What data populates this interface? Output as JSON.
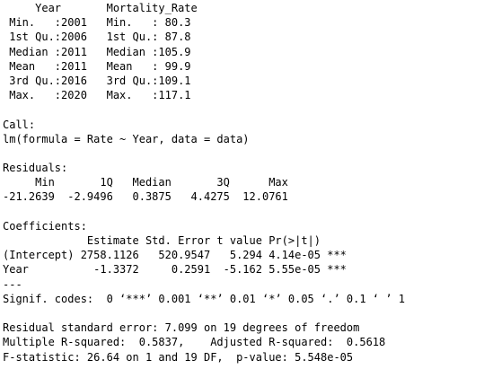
{
  "console_lines": [
    "     Year       Mortality_Rate  ",
    " Min.   :2001   Min.   : 80.3  ",
    " 1st Qu.:2006   1st Qu.: 87.8  ",
    " Median :2011   Median :105.9  ",
    " Mean   :2011   Mean   : 99.9  ",
    " 3rd Qu.:2016   3rd Qu.:109.1  ",
    " Max.   :2020   Max.   :117.1  ",
    "",
    "Call:",
    "lm(formula = Rate ~ Year, data = data)",
    "",
    "Residuals:",
    "     Min       1Q   Median       3Q      Max ",
    "-21.2639  -2.9496   0.3875   4.4275  12.0761 ",
    "",
    "Coefficients:",
    "             Estimate Std. Error t value Pr(>|t|)    ",
    "(Intercept) 2758.1126   520.9547   5.294 4.14e-05 ***",
    "Year          -1.3372     0.2591  -5.162 5.55e-05 ***",
    "---",
    "Signif. codes:  0 ‘***’ 0.001 ‘**’ 0.01 ‘*’ 0.05 ‘.’ 0.1 ‘ ’ 1",
    "",
    "Residual standard error: 7.099 on 19 degrees of freedom",
    "Multiple R-squared:  0.5837,\tAdjusted R-squared:  0.5618 ",
    "F-statistic: 26.64 on 1 and 19 DF,  p-value: 5.548e-05"
  ]
}
